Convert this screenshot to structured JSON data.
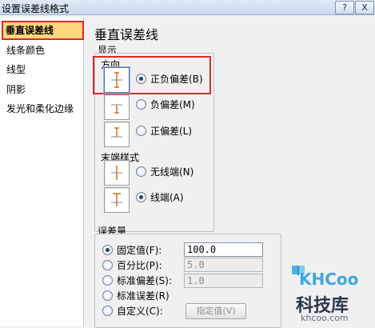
{
  "window": {
    "title": "设置误差线格式",
    "help_label": "?",
    "close_label": "X"
  },
  "sidebar": {
    "items": [
      {
        "label": "垂直误差线"
      },
      {
        "label": "线条颜色"
      },
      {
        "label": "线型"
      },
      {
        "label": "阴影"
      },
      {
        "label": "发光和柔化边缘"
      }
    ]
  },
  "main": {
    "heading": "垂直误差线",
    "display_group": "显示",
    "direction_group": "方向",
    "direction_options": [
      {
        "label": "正负偏差(B)",
        "checked": true
      },
      {
        "label": "负偏差(M)",
        "checked": false
      },
      {
        "label": "正偏差(L)",
        "checked": false
      }
    ],
    "end_style_group": "末端样式",
    "end_style_options": [
      {
        "label": "无线端(N)",
        "checked": false
      },
      {
        "label": "线端(A)",
        "checked": true
      }
    ],
    "amount_group": "误差量",
    "amount_options": [
      {
        "label": "固定值(F):",
        "checked": true,
        "value": "100.0",
        "enabled": true
      },
      {
        "label": "百分比(P):",
        "checked": false,
        "value": "5.0",
        "enabled": false
      },
      {
        "label": "标准偏差(S):",
        "checked": false,
        "value": "1.0",
        "enabled": false
      },
      {
        "label": "标准误差(R)",
        "checked": false
      },
      {
        "label": "自定义(C):",
        "checked": false
      }
    ],
    "specify_button": "指定值(V)"
  },
  "watermark": {
    "brand": "KHCoo",
    "site": "科技库",
    "url": "khcoo.com"
  },
  "colors": {
    "highlight_border": "#d8292b",
    "selected_bg": "#ffd77f",
    "accent": "#1e3c7a"
  }
}
